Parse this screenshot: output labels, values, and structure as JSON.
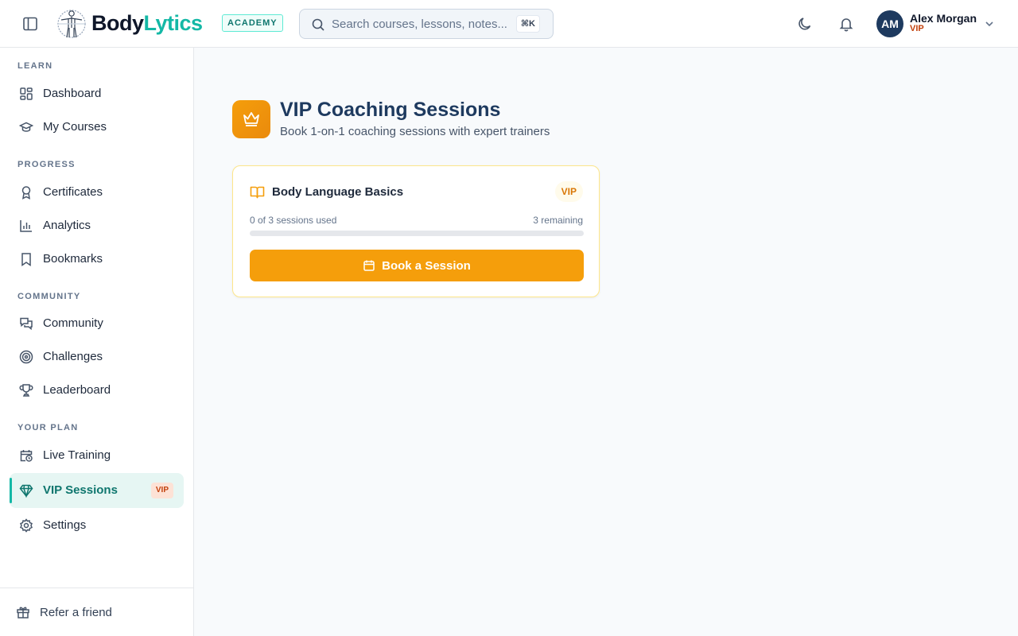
{
  "header": {
    "brand_part1": "Body",
    "brand_part2": "Lytics",
    "academy_badge": "ACADEMY",
    "search_placeholder": "Search courses, lessons, notes...",
    "search_shortcut": "⌘K",
    "user": {
      "initials": "AM",
      "name": "Alex Morgan",
      "tier": "VIP"
    }
  },
  "sidebar": {
    "sections": {
      "learn": "LEARN",
      "progress": "PROGRESS",
      "community": "COMMUNITY",
      "plan": "YOUR PLAN"
    },
    "items": {
      "dashboard": "Dashboard",
      "my_courses": "My Courses",
      "certificates": "Certificates",
      "analytics": "Analytics",
      "bookmarks": "Bookmarks",
      "community": "Community",
      "challenges": "Challenges",
      "leaderboard": "Leaderboard",
      "live_training": "Live Training",
      "vip_sessions": "VIP Sessions",
      "vip_badge": "VIP",
      "settings": "Settings"
    },
    "footer": {
      "refer": "Refer a friend"
    }
  },
  "main": {
    "title": "VIP Coaching Sessions",
    "subtitle": "Book 1-on-1 coaching sessions with expert trainers",
    "card": {
      "title": "Body Language Basics",
      "badge": "VIP",
      "usage_label": "0 of 3 sessions used",
      "remaining_label": "3 remaining",
      "sessions_used": 0,
      "sessions_total": 3,
      "button_label": "Book a Session"
    }
  },
  "colors": {
    "brand_teal": "#14b8a6",
    "accent_orange": "#f59e0b",
    "navy": "#1e3a5f",
    "vip_text": "#c2410c"
  }
}
